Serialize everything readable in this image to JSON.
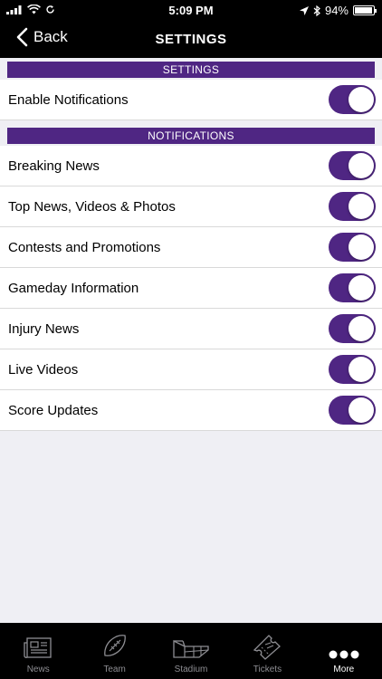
{
  "status_bar": {
    "time": "5:09 PM",
    "battery": "94%"
  },
  "nav": {
    "back_label": "Back",
    "title": "SETTINGS"
  },
  "sections": [
    {
      "header": "SETTINGS",
      "items": [
        {
          "label": "Enable Notifications",
          "enabled": true
        }
      ]
    },
    {
      "header": "NOTIFICATIONS",
      "items": [
        {
          "label": "Breaking News",
          "enabled": true
        },
        {
          "label": "Top News, Videos & Photos",
          "enabled": true
        },
        {
          "label": "Contests and Promotions",
          "enabled": true
        },
        {
          "label": "Gameday Information",
          "enabled": true
        },
        {
          "label": "Injury News",
          "enabled": true
        },
        {
          "label": "Live Videos",
          "enabled": true
        },
        {
          "label": "Score Updates",
          "enabled": true
        }
      ]
    }
  ],
  "tabs": [
    {
      "label": "News",
      "icon": "newspaper-icon"
    },
    {
      "label": "Team",
      "icon": "football-icon"
    },
    {
      "label": "Stadium",
      "icon": "stadium-icon"
    },
    {
      "label": "Tickets",
      "icon": "ticket-icon"
    },
    {
      "label": "More",
      "icon": "more-dots-icon",
      "active": true
    }
  ],
  "colors": {
    "accent": "#4f2683",
    "bar_background": "#000000",
    "page_background": "#efeff4"
  }
}
